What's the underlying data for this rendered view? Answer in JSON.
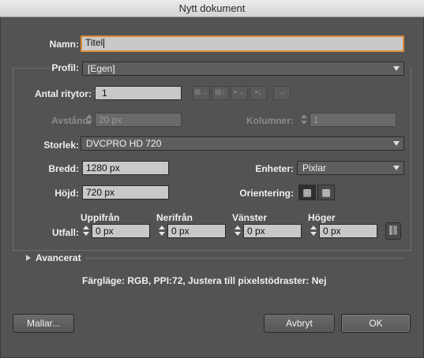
{
  "window": {
    "title": "Nytt dokument"
  },
  "name": {
    "label": "Namn:",
    "value": "Titel"
  },
  "profile": {
    "label": "Profil:",
    "value": "[Egen]"
  },
  "artboards": {
    "count_label": "Antal ritytor:",
    "count_value": "1",
    "spacing_label": "Avstånd:",
    "spacing_value": "20 px",
    "columns_label": "Kolumner:",
    "columns_value": "1",
    "layout_icons": [
      "grid-by-row-icon",
      "grid-by-column-icon",
      "arrange-by-row-icon",
      "arrange-by-column-icon",
      "right-to-left-icon"
    ]
  },
  "size": {
    "label": "Storlek:",
    "value": "DVCPRO HD 720"
  },
  "width": {
    "label": "Bredd:",
    "value": "1280 px"
  },
  "height": {
    "label": "Höjd:",
    "value": "720 px"
  },
  "units": {
    "label": "Enheter:",
    "value": "Pixlar"
  },
  "orientation": {
    "label": "Orientering:",
    "selected": "portrait"
  },
  "bleed": {
    "label": "Utfall:",
    "top_label": "Uppifrån",
    "top_value": "0 px",
    "bottom_label": "Nerifrån",
    "bottom_value": "0 px",
    "left_label": "Vänster",
    "left_value": "0 px",
    "right_label": "Höger",
    "right_value": "0 px"
  },
  "advanced": {
    "label": "Avancerat"
  },
  "summary": "Färgläge: RGB, PPI:72, Justera till pixelstödraster: Nej",
  "buttons": {
    "templates": "Mallar...",
    "cancel": "Avbryt",
    "ok": "OK"
  },
  "colors": {
    "panel": "#535353",
    "focus": "#d98a3a",
    "field": "#c8c8c8"
  }
}
